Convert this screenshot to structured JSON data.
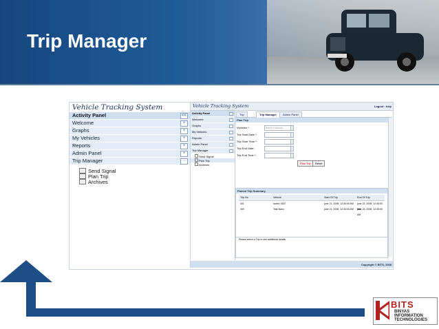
{
  "slide": {
    "title": "Trip Manager"
  },
  "outer_app": {
    "title": "Vehicle Tracking System",
    "panel_header": "Activity Panel",
    "panel_header_button": "<<",
    "items": [
      {
        "label": "Welcome",
        "button": "+"
      },
      {
        "label": "Graphs",
        "button": "+"
      },
      {
        "label": "My Vehicles",
        "button": "+"
      },
      {
        "label": "Reports",
        "button": "+"
      },
      {
        "label": "Admin Panel",
        "button": "+"
      },
      {
        "label": "Trip Manager",
        "button": "−"
      }
    ],
    "subitems": [
      {
        "label": "Send Signal"
      },
      {
        "label": "Plan Trip"
      },
      {
        "label": "Archives"
      }
    ]
  },
  "inner_app": {
    "title": "Vehicle Tracking System",
    "logout": "Logout : bsly",
    "panel_header": "Activity Panel",
    "items": [
      "Welcome",
      "Graphs",
      "My Vehicles",
      "Reports",
      "Admin Panel",
      "Trip Manager"
    ],
    "subitems": [
      "Send Signal",
      "Plan Trip",
      "Archives"
    ],
    "tabs": [
      {
        "label": "Trip",
        "active": false
      },
      {
        "label": "Trip Manager",
        "active": true
      },
      {
        "label": "Admin Panel",
        "active": false
      }
    ],
    "plan_trip": {
      "header": "Plan Trip",
      "fields": [
        {
          "label": "Vehicles *:",
          "placeholder": "Select a vehicle..."
        },
        {
          "label": "Trip Start Date *:",
          "placeholder": ""
        },
        {
          "label": "Trip Start Time *:",
          "placeholder": ""
        },
        {
          "label": "Trip End Date:",
          "placeholder": ""
        },
        {
          "label": "Trip End Time *:",
          "placeholder": ""
        }
      ],
      "plan_button": "Plan Trip",
      "reset_button": "Reset"
    },
    "summary": {
      "header": "Planed Trip Summary",
      "columns": [
        "Trip No",
        "Vehicle",
        "Start Of Trip",
        "End Of Trip"
      ],
      "rows": [
        [
          "401",
          "santro 4307",
          "june 21, 2008, 12:30:00 AM",
          "june 22, 2008, 12:45:00 AM"
        ],
        [
          "400",
          "Tata Nano",
          "june 21, 2008, 12:30:00 AM",
          "june 23, 2008, 12:45:00 AM"
        ]
      ],
      "note": "Please select a Trip to see additional details"
    },
    "footer": "Copyright © BITS, 2008"
  },
  "logo": {
    "name": "BITS",
    "lines": [
      "BINYAS",
      "INFORMATION",
      "TECHNOLOGIES"
    ],
    "colors": {
      "red": "#b3211f",
      "dark": "#222222"
    }
  },
  "colors": {
    "header_blue": "#1f5b98",
    "arrow_blue": "#1d4f86"
  }
}
